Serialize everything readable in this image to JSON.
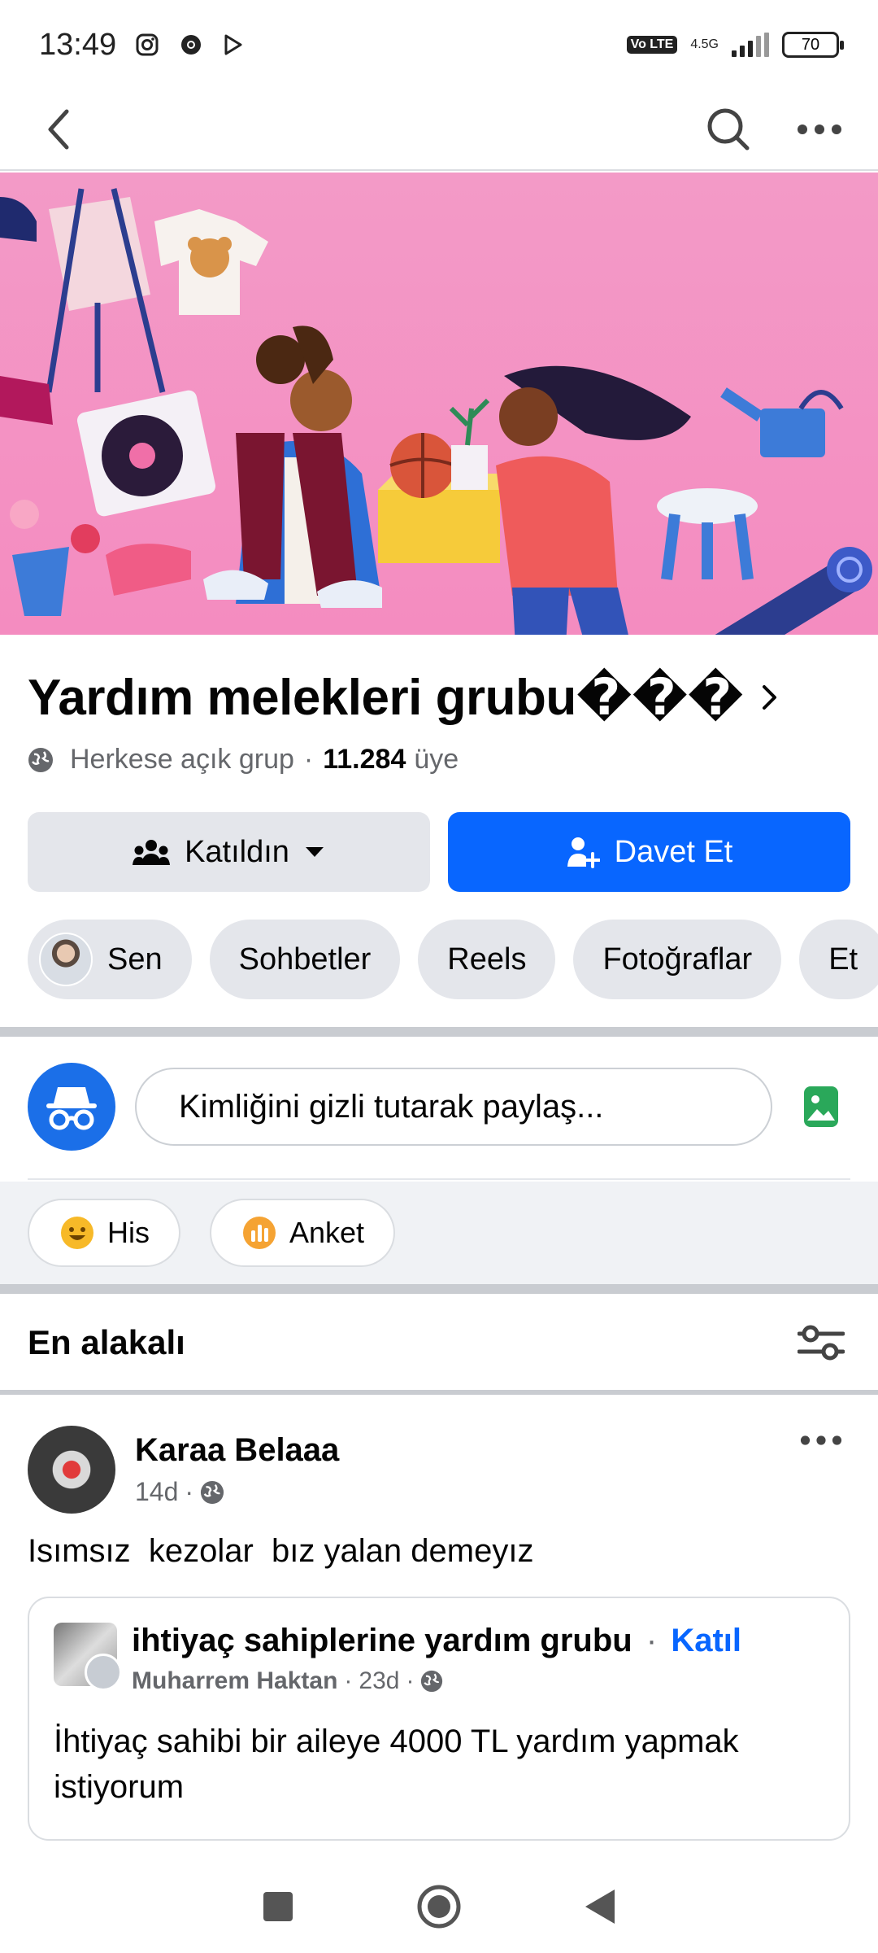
{
  "status_bar": {
    "time": "13:49",
    "network": "4.5G",
    "volte": "Vo LTE",
    "battery": "70"
  },
  "nav": {
    "icons": [
      "back-arrow-icon",
      "search-icon",
      "more-icon"
    ]
  },
  "group": {
    "title": "Yardım melekleri grubu���",
    "privacy": "Herkese açık grup",
    "separator": "·",
    "member_count": "11.284",
    "member_label": "üye"
  },
  "actions": {
    "joined_label": "Katıldın",
    "invite_label": "Davet Et"
  },
  "tabs": [
    "Sen",
    "Sohbetler",
    "Reels",
    "Fotoğraflar",
    "Et"
  ],
  "composer": {
    "placeholder": "Kimliğini gizli tutarak paylaş...",
    "feeling_label": "His",
    "poll_label": "Anket"
  },
  "feed": {
    "sort_label": "En alakalı"
  },
  "post": {
    "author": "Karaa Belaaa",
    "time": "14d",
    "dot": "·",
    "text": "Isımsız  kezolar  bız yalan demeyız",
    "shared": {
      "group_name": "ihtiyaç sahiplerine yardım grubu",
      "dot": "·",
      "join_label": "Katıl",
      "author": "Muharrem Haktan",
      "time": "23d",
      "text": "İhtiyaç sahibi bir aileye 4000 TL yardım yapmak istiyorum"
    }
  },
  "colors": {
    "primary": "#0866ff",
    "secondary_button": "#e4e6eb",
    "cover_background": "#f48cc0",
    "anon_avatar": "#1b6fe8",
    "photo_icon": "#2aa85a",
    "feeling_icon": "#f7b928",
    "poll_icon": "#f5a333"
  }
}
